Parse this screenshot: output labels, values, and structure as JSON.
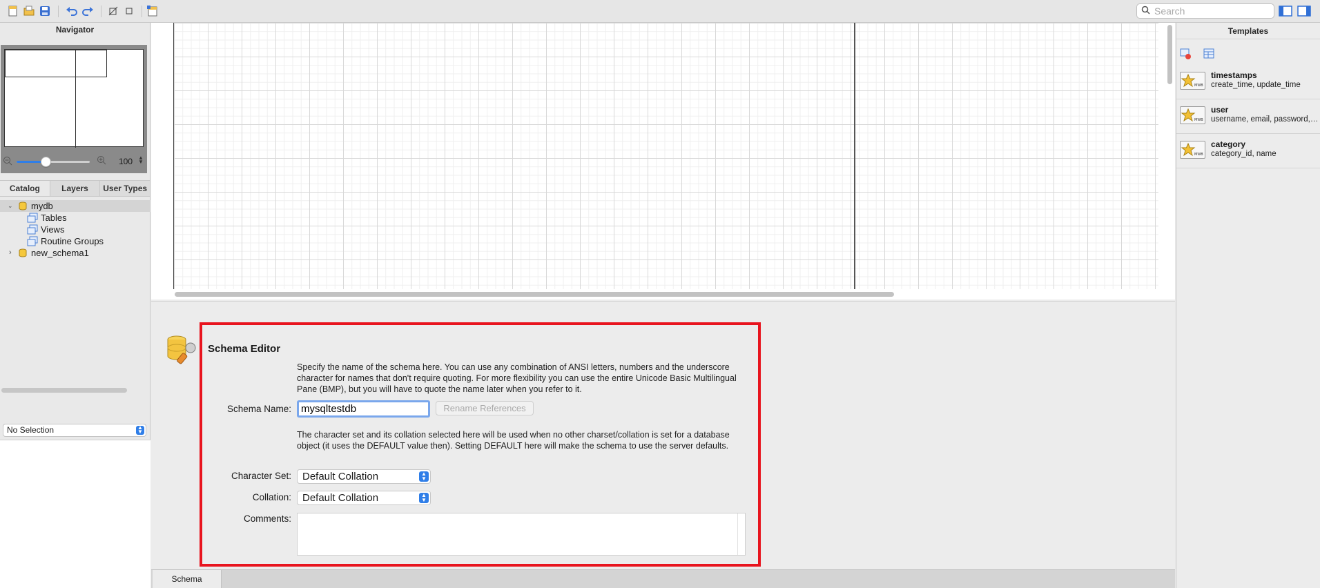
{
  "toolbar": {
    "search": {
      "placeholder": "Search"
    },
    "icons": [
      "new-document-icon",
      "open-folder-icon",
      "save-icon",
      "undo-icon",
      "redo-icon",
      "toggle-grid-icon",
      "align-icon",
      "new-diagram-icon"
    ]
  },
  "navigator": {
    "title": "Navigator",
    "zoom": {
      "value": "100",
      "slider_fraction": 0.4
    }
  },
  "catalog_tabs": [
    "Catalog",
    "Layers",
    "User Types"
  ],
  "tree": {
    "schema": "mydb",
    "children": [
      "Tables",
      "Views",
      "Routine Groups"
    ],
    "other_schema": "new_schema1"
  },
  "properties": {
    "selection": "No Selection"
  },
  "editor": {
    "title": "Schema Editor",
    "name_description": "Specify the name of the schema here. You can use any combination of ANSI letters, numbers and the underscore character for names that don't require quoting. For more flexibility you can use the entire Unicode Basic Multilingual Pane (BMP), but you will have to quote the name later when you refer to it.",
    "schema_name_label": "Schema Name:",
    "schema_name_value": "mysqltestdb",
    "rename_button": "Rename References",
    "charset_description": "The character set and its collation selected here will be used when no other charset/collation is set for a database object (it uses the DEFAULT value then). Setting DEFAULT here will make the schema to use the server defaults.",
    "charset_label": "Character Set:",
    "charset_value": "Default Collation",
    "collation_label": "Collation:",
    "collation_value": "Default Collation",
    "comments_label": "Comments:",
    "comments_value": ""
  },
  "bottom_tabs": [
    "Schema"
  ],
  "templates": {
    "title": "Templates",
    "items": [
      {
        "name": "timestamps",
        "fields": "create_time, update_time",
        "badge": "MWB"
      },
      {
        "name": "user",
        "fields": "username, email, password, cr...",
        "badge": "MWB"
      },
      {
        "name": "category",
        "fields": "category_id, name",
        "badge": "MWB"
      }
    ]
  },
  "colors": {
    "accent": "#2f7ee8",
    "highlight_border": "#e8141e",
    "input_focus": "#7aa7ec"
  }
}
